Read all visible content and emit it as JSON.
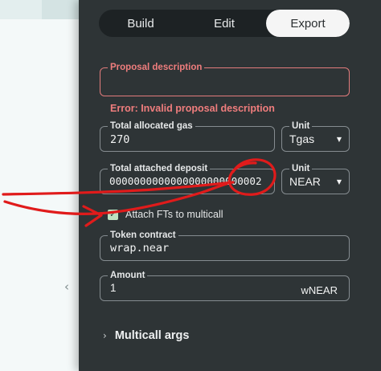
{
  "tabs": [
    {
      "label": "Build",
      "active": false
    },
    {
      "label": "Edit",
      "active": false
    },
    {
      "label": "Export",
      "active": true
    }
  ],
  "proposal": {
    "legend": "Proposal description",
    "value": "",
    "error": "Error: Invalid proposal description"
  },
  "gas": {
    "legend": "Total allocated gas",
    "value": "270",
    "unit_legend": "Unit",
    "unit_value": "Tgas"
  },
  "deposit": {
    "legend": "Total attached deposit",
    "value": "0000000000000000000000002",
    "unit_legend": "Unit",
    "unit_value": "NEAR"
  },
  "attach_fts": {
    "label": "Attach FTs to multicall",
    "checked": true
  },
  "token": {
    "legend": "Token contract",
    "value": "wrap.near"
  },
  "amount": {
    "legend": "Amount",
    "value": "1",
    "unit": "wNEAR"
  },
  "multicall_args": {
    "label": "Multicall args"
  },
  "colors": {
    "panel_bg": "#2e3436",
    "error": "#ef7d7d",
    "annotation": "#e01b1b",
    "checkbox": "#bfe2c1"
  }
}
